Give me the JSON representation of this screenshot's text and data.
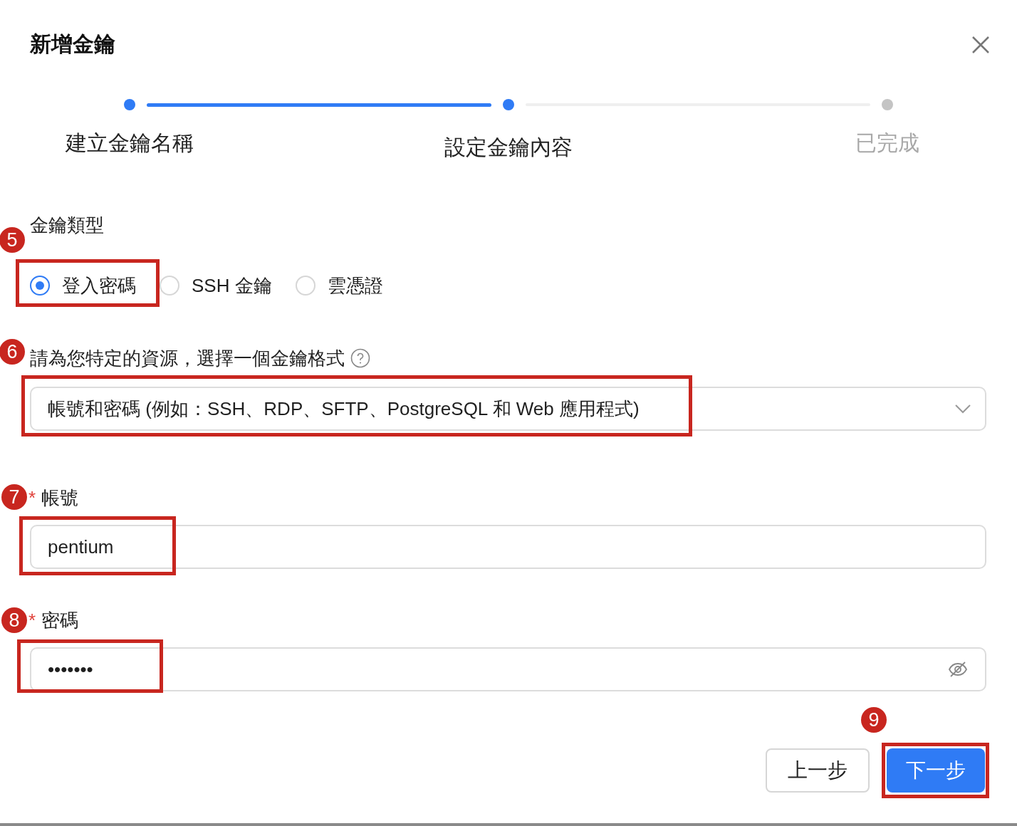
{
  "dialog": {
    "title": "新增金鑰"
  },
  "steps": [
    {
      "label": "建立金鑰名稱",
      "done": true,
      "current": false
    },
    {
      "label": "設定金鑰內容",
      "done": false,
      "current": true
    },
    {
      "label": "已完成",
      "done": false,
      "current": false
    }
  ],
  "key_type": {
    "label": "金鑰類型",
    "options": [
      {
        "label": "登入密碼",
        "selected": true
      },
      {
        "label": "SSH 金鑰",
        "selected": false
      },
      {
        "label": "雲憑證",
        "selected": false
      }
    ]
  },
  "format": {
    "label": "請為您特定的資源，選擇一個金鑰格式",
    "value": "帳號和密碼 (例如：SSH、RDP、SFTP、PostgreSQL 和 Web 應用程式)"
  },
  "account": {
    "label": "帳號",
    "required_mark": "*",
    "value": "pentium"
  },
  "password": {
    "label": "密碼",
    "required_mark": "*",
    "value": "•••••••"
  },
  "buttons": [
    {
      "label": "上一步",
      "kind": "secondary"
    },
    {
      "label": "下一步",
      "kind": "primary"
    }
  ],
  "annotations": [
    {
      "number": "5"
    },
    {
      "number": "6"
    },
    {
      "number": "7"
    },
    {
      "number": "8"
    },
    {
      "number": "9"
    }
  ]
}
